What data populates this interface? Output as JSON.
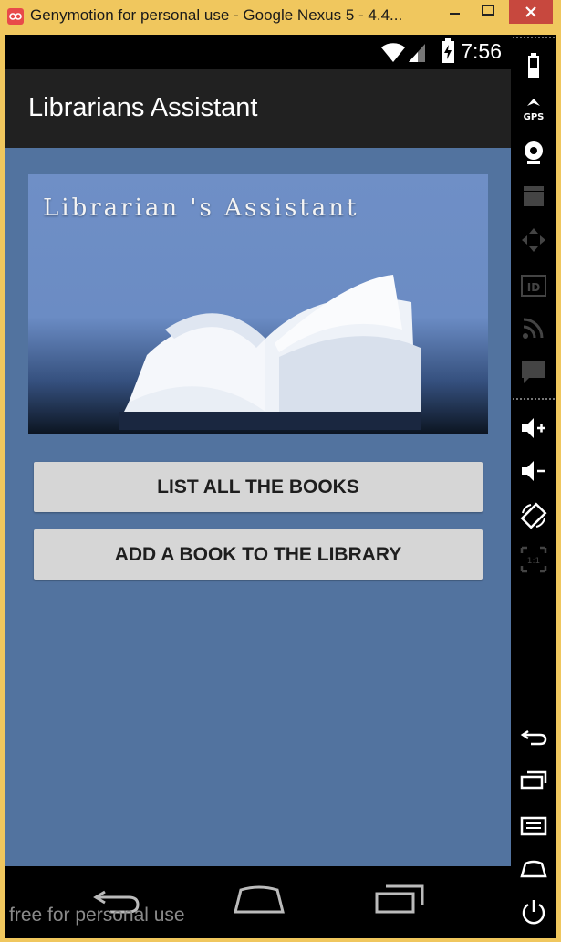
{
  "window": {
    "title": "Genymotion for personal use - Google Nexus 5 - 4.4...",
    "app_icon": "genymotion-icon",
    "controls": [
      "minimize-icon",
      "maximize-icon",
      "close-icon"
    ]
  },
  "status_bar": {
    "time": "7:56",
    "icons": [
      "wifi-icon",
      "signal-icon",
      "battery-charging-icon"
    ]
  },
  "action_bar": {
    "title": "Librarians Assistant"
  },
  "banner": {
    "text": "Librarian 's Assistant",
    "image": "open-book-image"
  },
  "buttons": {
    "list_books": "LIST ALL THE BOOKS",
    "add_book": "ADD A BOOK TO THE LIBRARY"
  },
  "nav_bar": {
    "icons": [
      "back-icon",
      "home-icon",
      "recent-apps-icon"
    ],
    "watermark": "free for personal use"
  },
  "side_toolbar": {
    "icons": [
      "battery-icon",
      "gps-icon",
      "webcam-icon",
      "screencast-icon",
      "dpad-icon",
      "device-id-icon",
      "rss-icon",
      "sms-icon",
      "volume-up-icon",
      "volume-down-icon",
      "rotate-icon",
      "pixel-perfect-icon",
      "back-icon",
      "recent-apps-icon",
      "menu-icon",
      "home-icon",
      "power-icon"
    ]
  },
  "colors": {
    "window_frame": "#f0c75e",
    "close_button": "#c7483e",
    "action_bar": "#212121",
    "content_bg": "#52739f",
    "button_bg": "#d6d6d6"
  }
}
